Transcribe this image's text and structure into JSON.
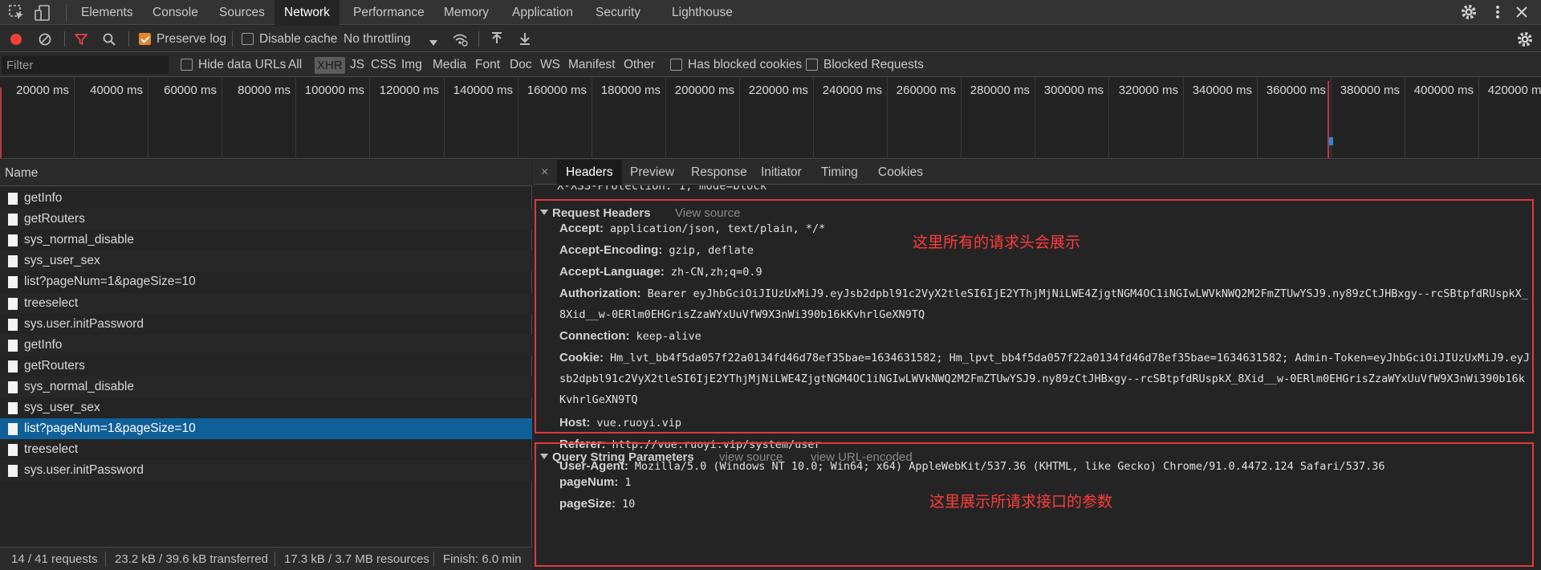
{
  "devtools": {
    "tabs": [
      "Elements",
      "Console",
      "Sources",
      "Network",
      "Performance",
      "Memory",
      "Application",
      "Security",
      "Lighthouse"
    ],
    "active_tab": "Network"
  },
  "toolbar": {
    "preserve_log": "Preserve log",
    "disable_cache": "Disable cache",
    "throttling": "No throttling"
  },
  "filter": {
    "placeholder": "Filter",
    "hide_data_urls": "Hide data URLs",
    "types": [
      "All",
      "XHR",
      "JS",
      "CSS",
      "Img",
      "Media",
      "Font",
      "Doc",
      "WS",
      "Manifest",
      "Other"
    ],
    "active_type": "XHR",
    "has_blocked_cookies": "Has blocked cookies",
    "blocked_requests": "Blocked Requests"
  },
  "overview": {
    "labels": [
      "20000 ms",
      "40000 ms",
      "60000 ms",
      "80000 ms",
      "100000 ms",
      "120000 ms",
      "140000 ms",
      "160000 ms",
      "180000 ms",
      "200000 ms",
      "220000 ms",
      "240000 ms",
      "260000 ms",
      "280000 ms",
      "300000 ms",
      "320000 ms",
      "340000 ms",
      "360000 ms",
      "380000 ms",
      "400000 ms",
      "420000 ms"
    ]
  },
  "requests": {
    "header": "Name",
    "items": [
      "getInfo",
      "getRouters",
      "sys_normal_disable",
      "sys_user_sex",
      "list?pageNum=1&pageSize=10",
      "treeselect",
      "sys.user.initPassword",
      "getInfo",
      "getRouters",
      "sys_normal_disable",
      "sys_user_sex",
      "list?pageNum=1&pageSize=10",
      "treeselect",
      "sys.user.initPassword"
    ],
    "selected_index": 11
  },
  "status_bar": {
    "requests": "14 / 41 requests",
    "transferred": "23.2 kB / 39.6 kB transferred",
    "resources": "17.3 kB / 3.7 MB resources",
    "finish": "Finish: 6.0 min"
  },
  "detail": {
    "close": "×",
    "tabs": [
      "Headers",
      "Preview",
      "Response",
      "Initiator",
      "Timing",
      "Cookies"
    ],
    "active_tab": "Headers",
    "clipped_line": "X-XSS-Protection: 1; mode=block",
    "request_headers": {
      "title": "Request Headers",
      "view_source": "View source",
      "rows": [
        {
          "key": "Accept:",
          "value": "application/json, text/plain, */*"
        },
        {
          "key": "Accept-Encoding:",
          "value": "gzip, deflate"
        },
        {
          "key": "Accept-Language:",
          "value": "zh-CN,zh;q=0.9"
        },
        {
          "key": "Authorization:",
          "value": "Bearer eyJhbGciOiJIUzUxMiJ9.eyJsb2dpbl91c2VyX2tleSI6IjE2YThjMjNiLWE4ZjgtNGM4OC1iNGIwLWVkNWQ2M2FmZTUwYSJ9.ny89zCtJHBxgy--rcSBtpfdRUspkX_8Xid__w-0ERlm0EHGrisZzaWYxUuVfW9X3nWi390b16kKvhrlGeXN9TQ"
        },
        {
          "key": "Connection:",
          "value": "keep-alive"
        },
        {
          "key": "Cookie:",
          "value": "Hm_lvt_bb4f5da057f22a0134fd46d78ef35bae=1634631582; Hm_lpvt_bb4f5da057f22a0134fd46d78ef35bae=1634631582; Admin-Token=eyJhbGciOiJIUzUxMiJ9.eyJsb2dpbl91c2VyX2tleSI6IjE2YThjMjNiLWE4ZjgtNGM4OC1iNGIwLWVkNWQ2M2FmZTUwYSJ9.ny89zCtJHBxgy--rcSBtpfdRUspkX_8Xid__w-0ERlm0EHGrisZzaWYxUuVfW9X3nWi390b16kKvhrlGeXN9TQ"
        },
        {
          "key": "Host:",
          "value": "vue.ruoyi.vip"
        },
        {
          "key": "Referer:",
          "value": "http://vue.ruoyi.vip/system/user"
        },
        {
          "key": "User-Agent:",
          "value": "Mozilla/5.0 (Windows NT 10.0; Win64; x64) AppleWebKit/537.36 (KHTML, like Gecko) Chrome/91.0.4472.124 Safari/537.36"
        }
      ],
      "annotation": "这里所有的请求头会展示"
    },
    "query_params": {
      "title": "Query String Parameters",
      "view_source": "view source",
      "view_url_encoded": "view URL-encoded",
      "rows": [
        {
          "key": "pageNum:",
          "value": "1"
        },
        {
          "key": "pageSize:",
          "value": "10"
        }
      ],
      "annotation": "这里展示所请求接口的参数"
    }
  },
  "colors": {
    "selected_row": "#0f5f99",
    "annotation_red": "#e0393b",
    "record_red": "#f0413d",
    "filter_icon_red": "#e8433e",
    "checkbox_orange": "#e0862b"
  }
}
